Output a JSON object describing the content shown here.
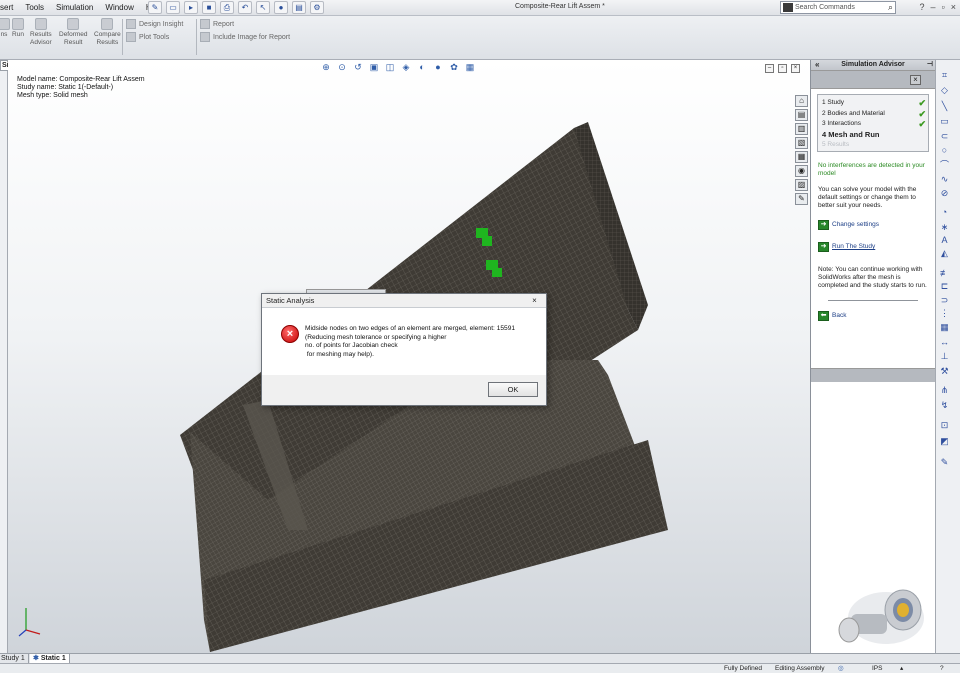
{
  "app": {
    "menu": [
      "sert",
      "Tools",
      "Simulation",
      "Window",
      "Help"
    ],
    "document_title": "Composite-Rear Lift Assem *",
    "search_placeholder": "Search Commands"
  },
  "command_manager": {
    "items": [
      {
        "label": "ns",
        "left": 0
      },
      {
        "label": "Run"
      },
      {
        "label": "Results\nAdvisor"
      },
      {
        "label": "Deformed\nResult"
      },
      {
        "label": "Compare\nResults"
      }
    ],
    "design_insight": "Design Insight",
    "plot_tools": "Plot Tools",
    "report": "Report",
    "include_image": "Include Image for Report"
  },
  "left_tab": "Simulation",
  "model_info": {
    "line1": "Model name: Composite-Rear Lift Assem",
    "line2": "Study name: Static 1(-Default-)",
    "line3": "Mesh type: Solid mesh"
  },
  "advisor": {
    "title": "Simulation Advisor",
    "steps": [
      {
        "label": "1  Study",
        "done": true,
        "state": "normal"
      },
      {
        "label": "2  Bodies and Material",
        "done": true,
        "state": "normal"
      },
      {
        "label": "3  Interactions",
        "done": true,
        "state": "normal"
      },
      {
        "label": "4  Mesh and Run",
        "done": false,
        "state": "active"
      },
      {
        "label": "5  Results",
        "done": false,
        "state": "dim"
      }
    ],
    "interference_note": "No interferences are detected in your model",
    "solve_note": "You can solve your model with the default settings or change them to better suit your needs.",
    "change_settings": "Change settings",
    "run_study": "Run The Study",
    "continue_note": "Note: You can continue working with SolidWorks after the mesh is completed and the study starts to run.",
    "back": "Back"
  },
  "dialog": {
    "title": "Static Analysis",
    "message_lines": [
      "Midside nodes on two edges of an element are merged, element: 15591",
      "(Reducing mesh tolerance or specifying a higher",
      "no. of points for Jacobian check",
      " for meshing may help)."
    ],
    "ok": "OK"
  },
  "bottom_tabs": {
    "study": "Study 1",
    "static": "Static 1"
  },
  "status": {
    "defined": "Fully Defined",
    "editing": "Editing Assembly",
    "units": "IPS"
  },
  "colors": {
    "mesh_body": "#3f3b35",
    "mesh_lines": "#6e6a62",
    "advisor_link": "#27862a",
    "check": "#3b9a20"
  }
}
